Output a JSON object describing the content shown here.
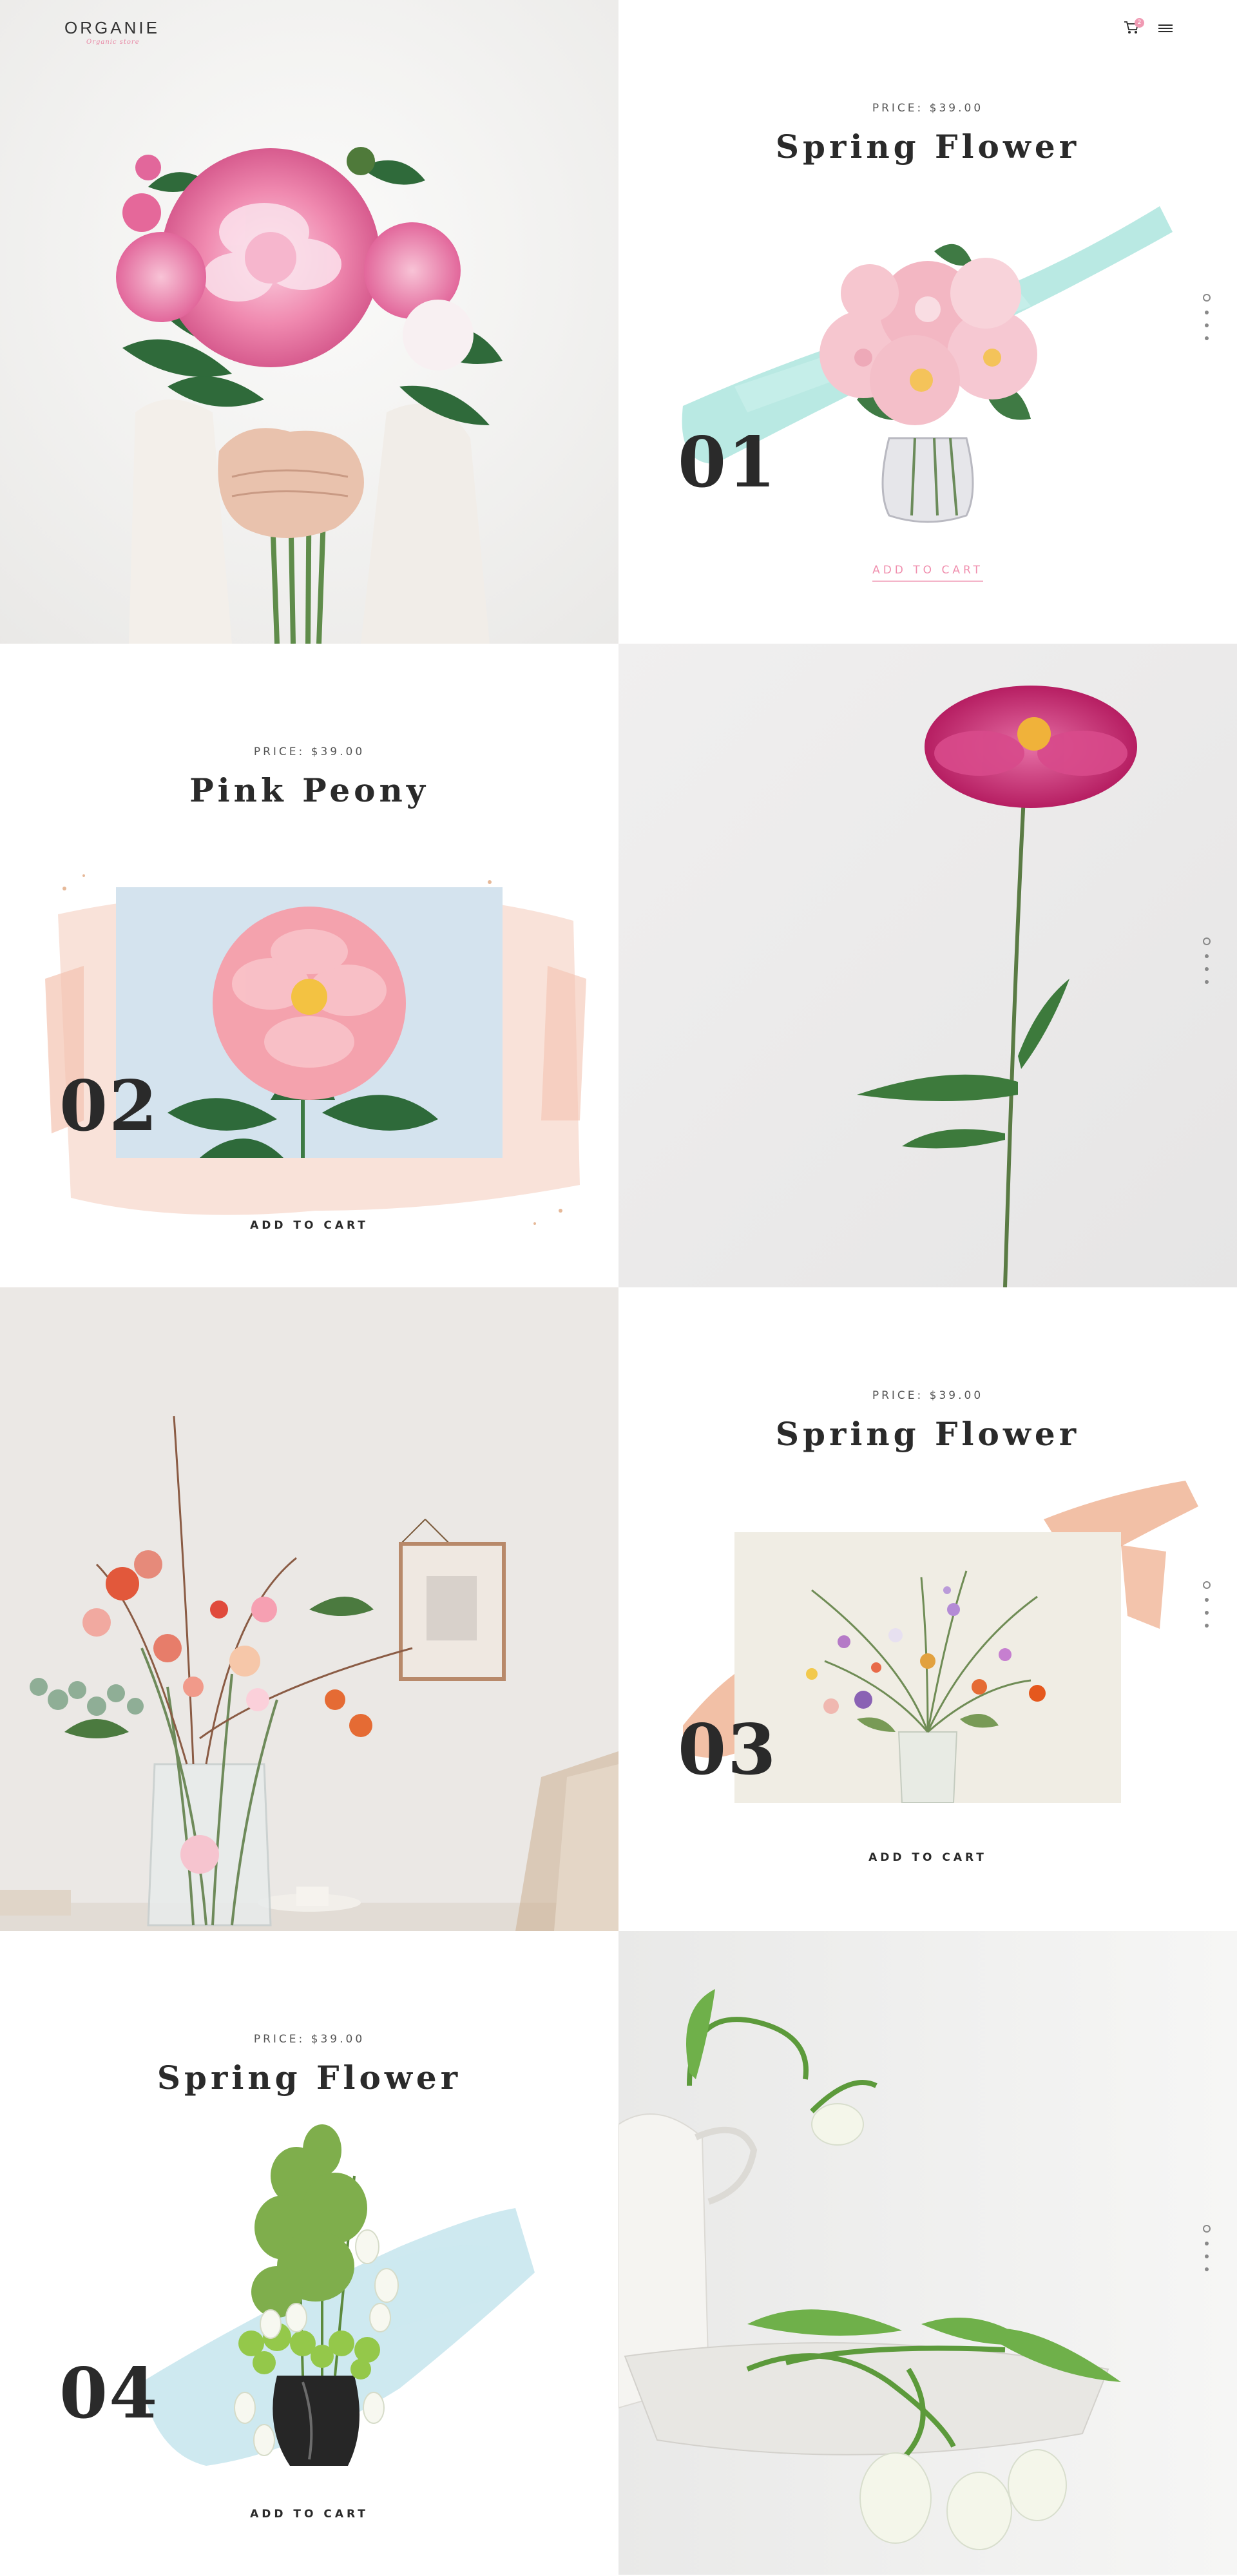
{
  "brand": {
    "name": "ORGANIE",
    "tagline": "Organic store"
  },
  "header": {
    "cart_icon": "cart-icon",
    "cart_count": "2",
    "menu_icon": "hamburger-icon"
  },
  "products": [
    {
      "number": "01",
      "price": "PRICE: $39.00",
      "title": "Spring Flower",
      "cta": "ADD TO CART"
    },
    {
      "number": "02",
      "price": "PRICE: $39.00",
      "title": "Pink Peony",
      "cta": "ADD TO CART"
    },
    {
      "number": "03",
      "price": "PRICE: $39.00",
      "title": "Spring Flower",
      "cta": "ADD TO CART"
    },
    {
      "number": "04",
      "price": "PRICE: $39.00",
      "title": "Spring Flower",
      "cta": "ADD TO CART"
    }
  ],
  "colors": {
    "accent": "#f08fae",
    "mint": "#a8e3dc",
    "peach": "#f0b597",
    "blush": "#f7d8cc",
    "text": "#2a2a2a"
  }
}
